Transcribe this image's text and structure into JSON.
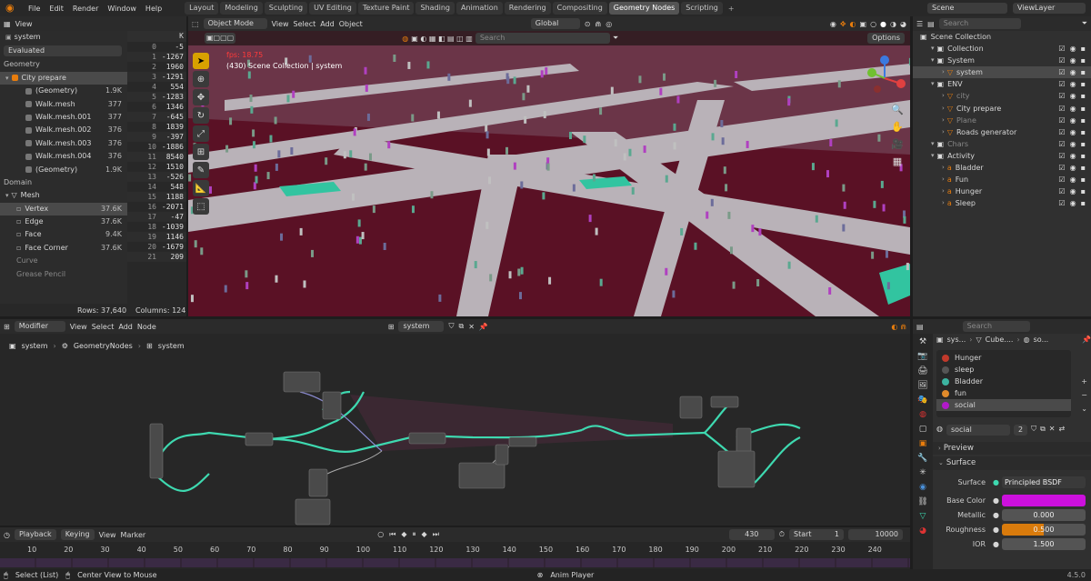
{
  "app": {
    "menus": [
      "File",
      "Edit",
      "Render",
      "Window",
      "Help"
    ],
    "workspaces": [
      "Layout",
      "Modeling",
      "Sculpting",
      "UV Editing",
      "Texture Paint",
      "Shading",
      "Animation",
      "Rendering",
      "Compositing",
      "Geometry Nodes",
      "Scripting"
    ],
    "active_workspace": "Geometry Nodes",
    "plus": "+",
    "scene": "Scene",
    "view_layer": "ViewLayer"
  },
  "spreadsheet": {
    "view_menu": "View",
    "object": "system",
    "mode": "Evaluated",
    "geometry_label": "Geometry",
    "root": "City prepare",
    "tree": [
      {
        "label": "(Geometry)",
        "value": "1.9K"
      },
      {
        "label": "Walk.mesh",
        "value": "377"
      },
      {
        "label": "Walk.mesh.001",
        "value": "377"
      },
      {
        "label": "Walk.mesh.002",
        "value": "376"
      },
      {
        "label": "Walk.mesh.003",
        "value": "376"
      },
      {
        "label": "Walk.mesh.004",
        "value": "376"
      },
      {
        "label": "(Geometry)",
        "value": "1.9K"
      }
    ],
    "domain_label": "Domain",
    "mesh_label": "Mesh",
    "domains": [
      {
        "label": "Vertex",
        "value": "37.6K"
      },
      {
        "label": "Edge",
        "value": "37.6K"
      },
      {
        "label": "Face",
        "value": "9.4K"
      },
      {
        "label": "Face Corner",
        "value": "37.6K"
      }
    ],
    "extra": [
      "Curve",
      "Grease Pencil"
    ],
    "col_header": "K",
    "index": [
      "0",
      "1",
      "2",
      "3",
      "4",
      "5",
      "6",
      "7",
      "8",
      "9",
      "10",
      "11",
      "12",
      "13",
      "14",
      "15",
      "16",
      "17",
      "18",
      "19",
      "20",
      "21"
    ],
    "values": [
      "-5",
      "-1267",
      "1960",
      "-1291",
      "554",
      "-1283",
      "1346",
      "-645",
      "1839",
      "-397",
      "-1886",
      "8540",
      "1510",
      "-526",
      "548",
      "1188",
      "-2071",
      "-47",
      "-1039",
      "1146",
      "-1679",
      "209"
    ],
    "rows": "Rows: 37,640",
    "columns": "Columns: 124"
  },
  "viewport": {
    "mode": "Object Mode",
    "menus": [
      "View",
      "Select",
      "Add",
      "Object"
    ],
    "orientation": "Global",
    "search_placeholder": "Search",
    "options": "Options",
    "fps": "fps: 18.75",
    "collection": "(430) Scene Collection | system"
  },
  "outliner": {
    "search_placeholder": "Search",
    "scene_collection": "Scene Collection",
    "items": [
      {
        "label": "Collection",
        "level": 1
      },
      {
        "label": "System",
        "level": 1
      },
      {
        "label": "system",
        "level": 2
      },
      {
        "label": "ENV",
        "level": 1
      },
      {
        "label": "city",
        "level": 2
      },
      {
        "label": "City prepare",
        "level": 2
      },
      {
        "label": "Plane",
        "level": 2
      },
      {
        "label": "Roads generator",
        "level": 2
      },
      {
        "label": "Chars",
        "level": 1
      },
      {
        "label": "Activity",
        "level": 1
      },
      {
        "label": "Bladder",
        "level": 2
      },
      {
        "label": "Fun",
        "level": 2
      },
      {
        "label": "Hunger",
        "level": 2
      },
      {
        "label": "Sleep",
        "level": 2
      }
    ]
  },
  "node_editor": {
    "editor": "Modifier",
    "menus": [
      "View",
      "Select",
      "Add",
      "Node"
    ],
    "tree_name": "system",
    "breadcrumb": [
      "system",
      "GeometryNodes",
      "system"
    ]
  },
  "properties": {
    "search_placeholder": "Search",
    "breadcrumb": [
      "sys...",
      "Cube....",
      "so..."
    ],
    "materials": [
      {
        "label": "Hunger",
        "color": "#c0392b"
      },
      {
        "label": "sleep",
        "color": "#555555"
      },
      {
        "label": "Bladder",
        "color": "#3cb3a0"
      },
      {
        "label": "fun",
        "color": "#e08a2b"
      },
      {
        "label": "social",
        "color": "#b11ac9"
      }
    ],
    "active_material": "social",
    "users": "2",
    "preview": "Preview",
    "surface_section": "Surface",
    "surface_label": "Surface",
    "surface_value": "Principled BSDF",
    "base_color_label": "Base Color",
    "base_color": "#cc10dd",
    "metallic_label": "Metallic",
    "metallic": "0.000",
    "roughness_label": "Roughness",
    "roughness": "0.500",
    "ior_label": "IOR",
    "ior": "1.500"
  },
  "timeline": {
    "menus": [
      "Playback",
      "Keying",
      "View",
      "Marker"
    ],
    "current_frame": "430",
    "start_label": "Start",
    "start": "1",
    "end": "10000",
    "ticks": [
      "10",
      "20",
      "30",
      "40",
      "50",
      "60",
      "70",
      "80",
      "90",
      "100",
      "110",
      "120",
      "130",
      "140",
      "150",
      "160",
      "170",
      "180",
      "190",
      "200",
      "210",
      "220",
      "230",
      "240"
    ]
  },
  "status": {
    "left1": "Select (List)",
    "left2": "Center View to Mouse",
    "center": "Anim Player",
    "version": "4.5.0"
  }
}
